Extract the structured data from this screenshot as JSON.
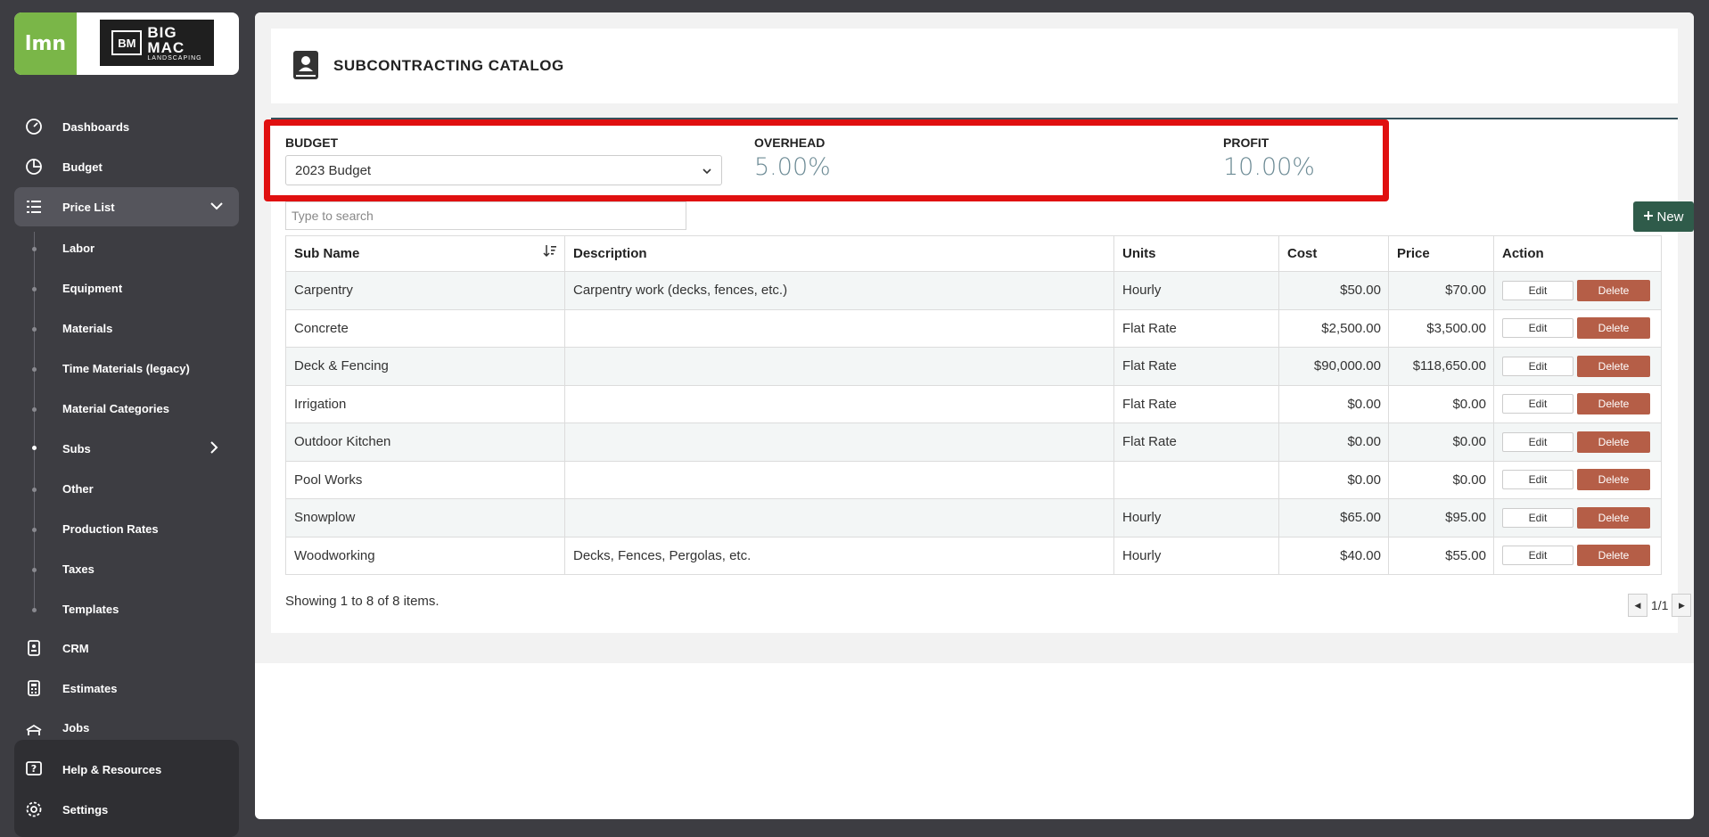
{
  "logo": {
    "brand": "lmn",
    "company_line1": "BIG",
    "company_line2": "MAC",
    "company_line3": "LANDSCAPING",
    "mark": "BM"
  },
  "nav": {
    "dashboards": "Dashboards",
    "budget": "Budget",
    "price_list": "Price List",
    "crm": "CRM",
    "estimates": "Estimates",
    "jobs": "Jobs",
    "help": "Help & Resources",
    "settings": "Settings"
  },
  "subnav": [
    "Labor",
    "Equipment",
    "Materials",
    "Time Materials (legacy)",
    "Material Categories",
    "Subs",
    "Other",
    "Production Rates",
    "Taxes",
    "Templates"
  ],
  "page": {
    "title": "SUBCONTRACTING CATALOG"
  },
  "summary": {
    "budget_label": "BUDGET",
    "budget_value": "2023 Budget",
    "overhead_label": "OVERHEAD",
    "overhead_value": "5.00%",
    "profit_label": "PROFIT",
    "profit_value": "10.00%"
  },
  "search": {
    "placeholder": "Type to search"
  },
  "new_button": "New",
  "table": {
    "headers": [
      "Sub Name",
      "Description",
      "Units",
      "Cost",
      "Price",
      "Action"
    ],
    "rows": [
      {
        "name": "Carpentry",
        "desc": "Carpentry work (decks, fences, etc.)",
        "units": "Hourly",
        "cost": "$50.00",
        "price": "$70.00"
      },
      {
        "name": "Concrete",
        "desc": "",
        "units": "Flat Rate",
        "cost": "$2,500.00",
        "price": "$3,500.00"
      },
      {
        "name": "Deck & Fencing",
        "desc": "",
        "units": "Flat Rate",
        "cost": "$90,000.00",
        "price": "$118,650.00"
      },
      {
        "name": "Irrigation",
        "desc": "",
        "units": "Flat Rate",
        "cost": "$0.00",
        "price": "$0.00"
      },
      {
        "name": "Outdoor Kitchen",
        "desc": "",
        "units": "Flat Rate",
        "cost": "$0.00",
        "price": "$0.00"
      },
      {
        "name": "Pool Works",
        "desc": "",
        "units": "",
        "cost": "$0.00",
        "price": "$0.00"
      },
      {
        "name": "Snowplow",
        "desc": "",
        "units": "Hourly",
        "cost": "$65.00",
        "price": "$95.00"
      },
      {
        "name": "Woodworking",
        "desc": "Decks, Fences, Pergolas, etc.",
        "units": "Hourly",
        "cost": "$40.00",
        "price": "$55.00"
      }
    ],
    "edit_label": "Edit",
    "delete_label": "Delete"
  },
  "footer": {
    "showing": "Showing 1 to 8 of 8 items.",
    "page": "1/1"
  }
}
